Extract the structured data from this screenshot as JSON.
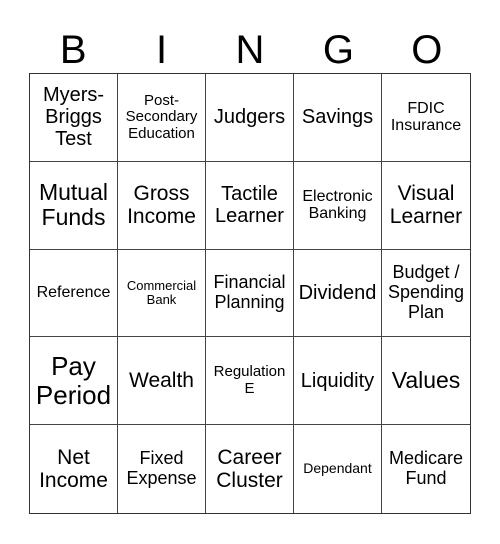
{
  "header": [
    "B",
    "I",
    "N",
    "G",
    "O"
  ],
  "cells": [
    [
      "Myers-\nBriggs\nTest",
      "Post-\nSecondary\nEducation",
      "Judgers",
      "Savings",
      "FDIC\nInsurance"
    ],
    [
      "Mutual\nFunds",
      "Gross\nIncome",
      "Tactile\nLearner",
      "Electronic\nBanking",
      "Visual\nLearner"
    ],
    [
      "Reference",
      "Commercial\nBank",
      "Financial\nPlanning",
      "Dividend",
      "Budget /\nSpending\nPlan"
    ],
    [
      "Pay\nPeriod",
      "Wealth",
      "Regulation\nE",
      "Liquidity",
      "Values"
    ],
    [
      "Net\nIncome",
      "Fixed\nExpense",
      "Career\nCluster",
      "Dependant",
      "Medicare\nFund"
    ]
  ]
}
